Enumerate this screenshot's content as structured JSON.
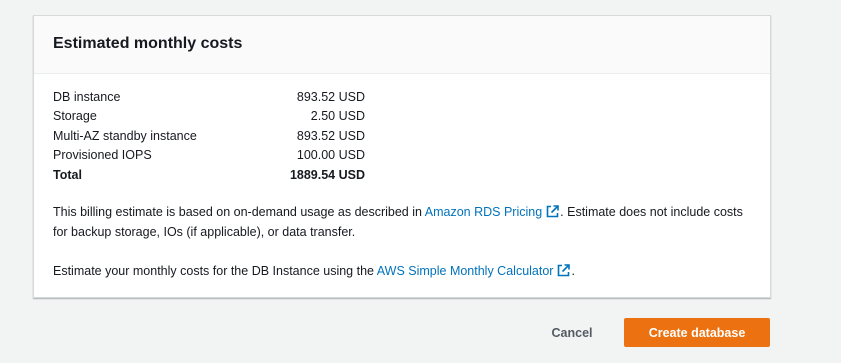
{
  "card": {
    "title": "Estimated monthly costs",
    "costs": [
      {
        "label": "DB instance",
        "value": "893.52 USD"
      },
      {
        "label": "Storage",
        "value": "2.50 USD"
      },
      {
        "label": "Multi-AZ standby instance",
        "value": "893.52 USD"
      },
      {
        "label": "Provisioned IOPS",
        "value": "100.00 USD"
      }
    ],
    "total": {
      "label": "Total",
      "value": "1889.54 USD"
    },
    "billing_note": {
      "before": "This billing estimate is based on on-demand usage as described in ",
      "link": "Amazon RDS Pricing",
      "after": ". Estimate does not include costs for backup storage, IOs (if applicable), or data transfer."
    },
    "calculator_note": {
      "before": "Estimate your monthly costs for the DB Instance using the ",
      "link": "AWS Simple Monthly Calculator",
      "after": "."
    },
    "link_icon": "external-link-icon"
  },
  "actions": {
    "cancel_label": "Cancel",
    "create_label": "Create database"
  },
  "colors": {
    "link": "#0073bb",
    "primary_button": "#ec7211",
    "background": "#f2f3f3"
  }
}
